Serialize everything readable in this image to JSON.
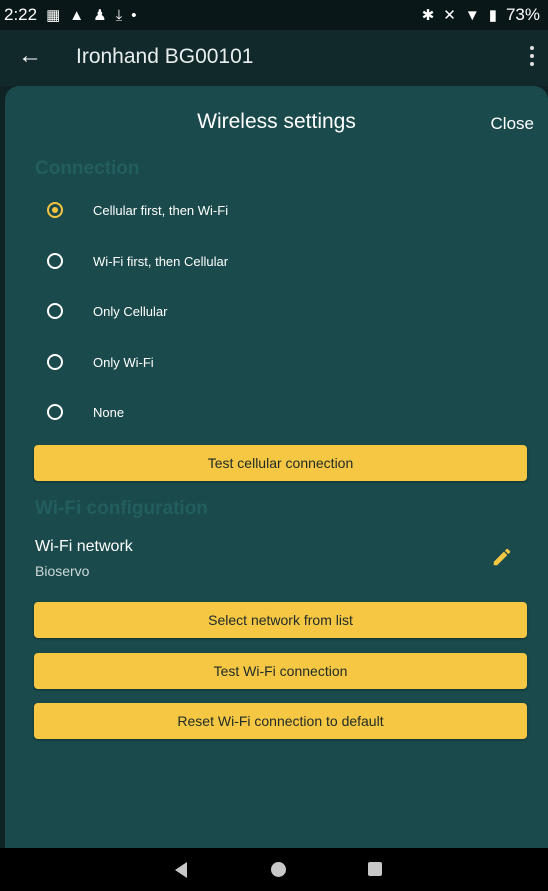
{
  "status_bar": {
    "time": "2:22",
    "left_icons": [
      "gallery-icon",
      "warning-icon",
      "person-icon",
      "download-icon",
      "dot-icon"
    ],
    "right_icons": [
      "bluetooth-icon",
      "mute-icon",
      "wifi-icon",
      "battery-icon"
    ],
    "battery": "73%"
  },
  "app_bar": {
    "title": "Ironhand BG00101"
  },
  "sheet": {
    "title": "Wireless settings",
    "close_label": "Close",
    "connection_header": "Connection",
    "options": [
      {
        "label": "Cellular first, then Wi-Fi",
        "selected": true
      },
      {
        "label": "Wi-Fi first, then Cellular",
        "selected": false
      },
      {
        "label": "Only Cellular",
        "selected": false
      },
      {
        "label": "Only Wi-Fi",
        "selected": false
      },
      {
        "label": "None",
        "selected": false
      }
    ],
    "test_cellular_label": "Test cellular connection",
    "wifi_header": "Wi-Fi configuration",
    "wifi_network_label": "Wi-Fi network",
    "wifi_network_value": "Bioservo",
    "select_network_label": "Select network from list",
    "test_wifi_label": "Test Wi-Fi connection",
    "reset_wifi_label": "Reset Wi-Fi connection to default"
  },
  "colors": {
    "accent": "#f5c742",
    "sheet_background": "#1a4a4b",
    "app_bar": "#11292b"
  }
}
